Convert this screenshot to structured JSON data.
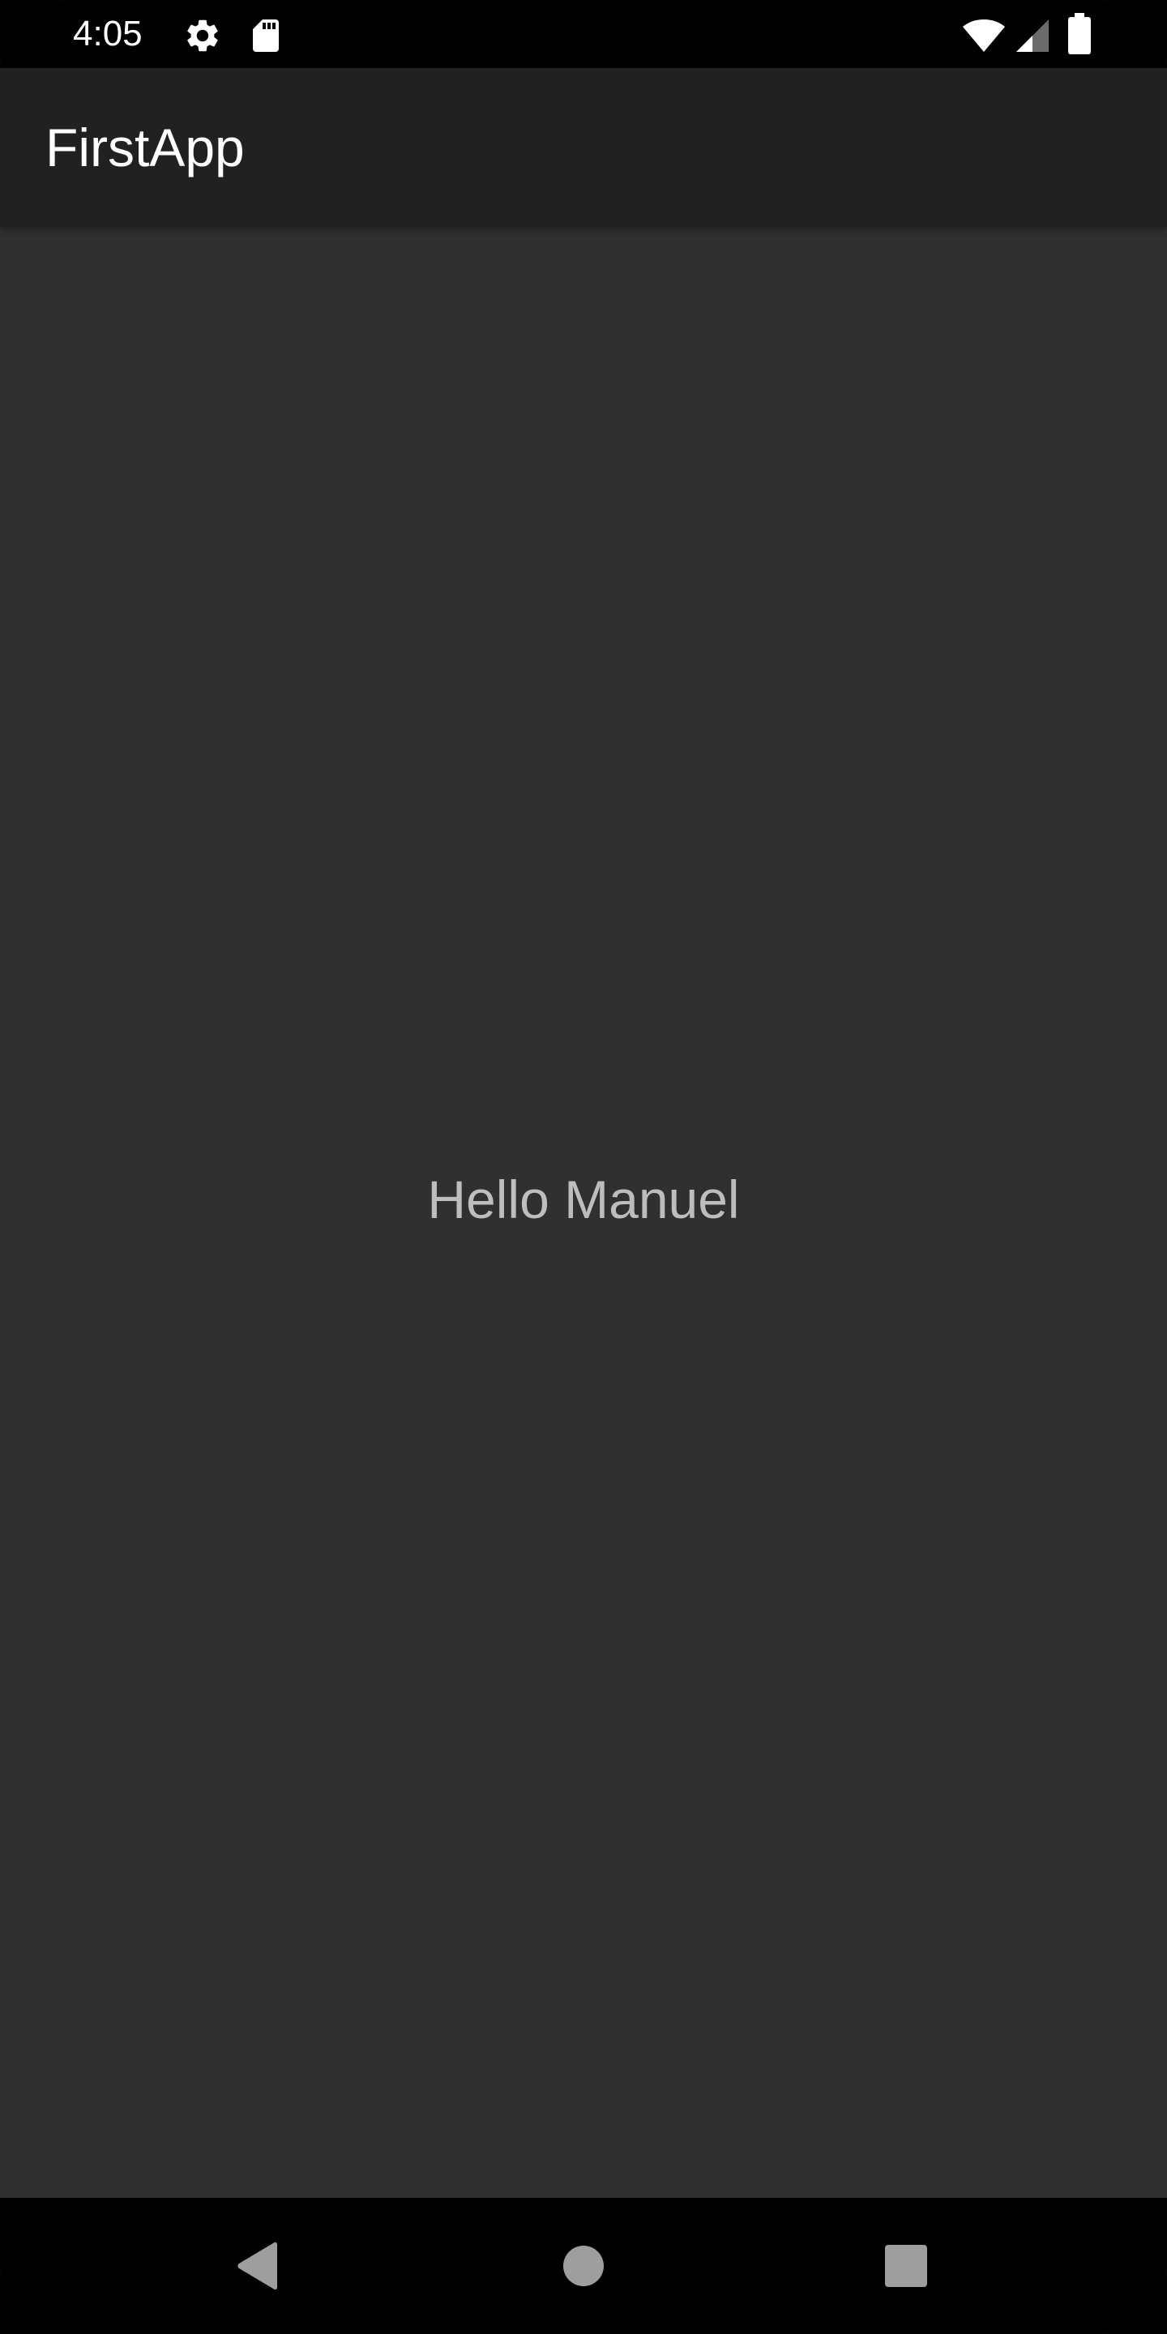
{
  "status_bar": {
    "time": "4:05",
    "icons": [
      "settings-icon",
      "sd-card-icon",
      "wifi-icon",
      "cell-signal-icon",
      "battery-icon"
    ]
  },
  "app_bar": {
    "title": "FirstApp"
  },
  "main": {
    "greeting": "Hello Manuel"
  },
  "nav_bar": {
    "buttons": [
      "back-button",
      "home-button",
      "recents-button"
    ]
  },
  "colors": {
    "background": "#303030",
    "app_bar": "#212121",
    "status_bar": "#000000",
    "greeting_text": "#bdbdbd",
    "nav_icon": "#9e9e9e"
  }
}
